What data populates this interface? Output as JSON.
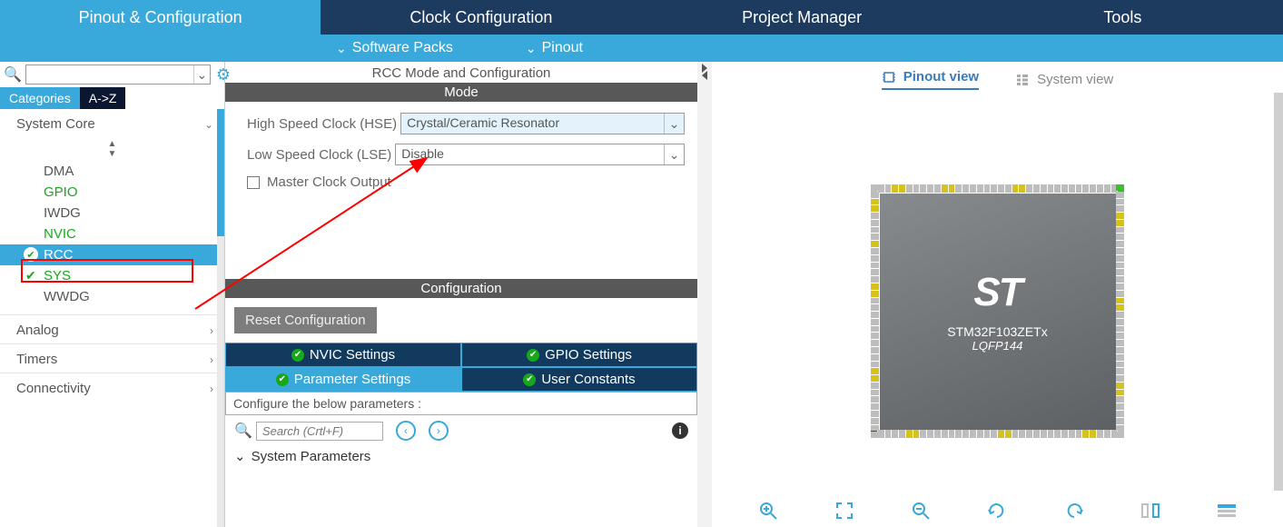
{
  "tabs": {
    "pinout": "Pinout & Configuration",
    "clock": "Clock Configuration",
    "project": "Project Manager",
    "tools": "Tools"
  },
  "subbar": {
    "software_packs": "Software Packs",
    "pinout": "Pinout"
  },
  "sidebar": {
    "cat_tab_categories": "Categories",
    "cat_tab_az": "A->Z",
    "sections": {
      "system_core": "System Core",
      "analog": "Analog",
      "timers": "Timers",
      "connectivity": "Connectivity"
    },
    "system_core_items": {
      "dma": "DMA",
      "gpio": "GPIO",
      "iwdg": "IWDG",
      "nvic": "NVIC",
      "rcc": "RCC",
      "sys": "SYS",
      "wwdg": "WWDG"
    }
  },
  "center": {
    "title": "RCC Mode and Configuration",
    "mode_header": "Mode",
    "hse_label": "High Speed Clock (HSE)",
    "hse_value": "Crystal/Ceramic Resonator",
    "lse_label": "Low Speed Clock (LSE)",
    "lse_value": "Disable",
    "master_clock_output": "Master Clock Output",
    "config_header": "Configuration",
    "reset_btn": "Reset Configuration",
    "tabs": {
      "nvic": "NVIC Settings",
      "gpio": "GPIO Settings",
      "param": "Parameter Settings",
      "user": "User Constants"
    },
    "hint": "Configure the below parameters :",
    "search_placeholder": "Search (Crtl+F)",
    "system_parameters": "System Parameters"
  },
  "right": {
    "pinout_view": "Pinout view",
    "system_view": "System view",
    "chip_part": "STM32F103ZETx",
    "chip_pkg": "LQFP144",
    "logo": "ST"
  }
}
